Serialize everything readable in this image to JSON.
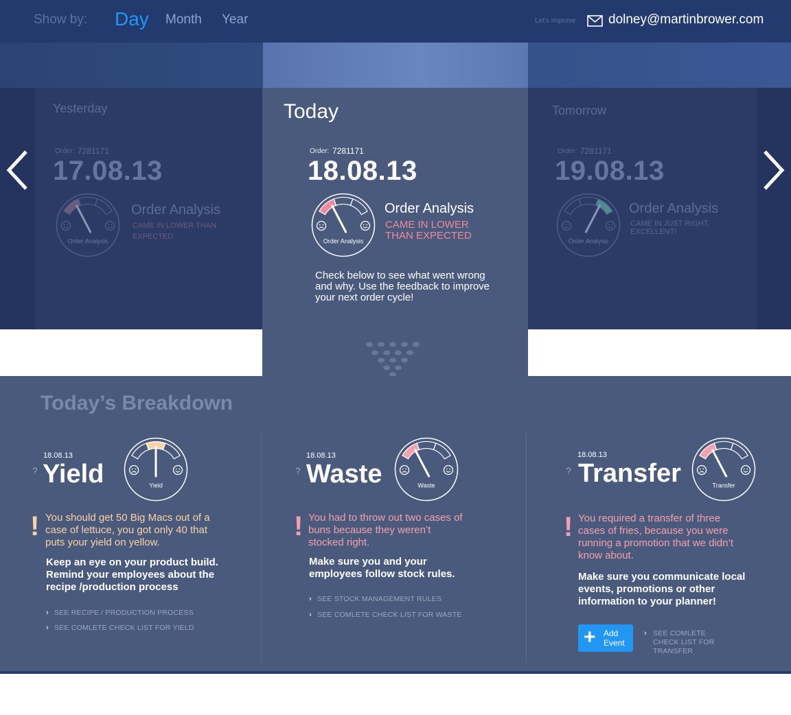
{
  "header": {
    "show_by_label": "Show by:",
    "periods": [
      {
        "label": "Day",
        "active": true
      },
      {
        "label": "Month",
        "active": false
      },
      {
        "label": "Year",
        "active": false
      }
    ],
    "improve_label": "Let's improve",
    "email": "dolney@martinbrower.com",
    "accent": "#2196f3"
  },
  "carousel": {
    "yesterday": {
      "label": "Yesterday",
      "order_label": "Order:",
      "order_number": "7281171",
      "date": "17.08.13",
      "gauge_label": "Order Analysis",
      "analysis_title": "Order Analysis",
      "analysis_result": "CAME IN LOWER THAN EXPECTED",
      "gauge_level": 0.25
    },
    "today": {
      "label": "Today",
      "order_label": "Order:",
      "order_number": "7281171",
      "date": "18.08.13",
      "gauge_label": "Order Analysis",
      "analysis_title": "Order Analysis",
      "analysis_result": "CAME IN LOWER THAN EXPECTED",
      "message": "Check below to see what went wrong and why. Use the feedback to improve your next order cycle!",
      "gauge_level": 0.25
    },
    "tomorrow": {
      "label": "Tomorrow",
      "order_label": "Order:",
      "order_number": "7281171",
      "date": "19.08.13",
      "gauge_label": "Order Analysis",
      "analysis_title": "Order Analysis",
      "analysis_result": "CAME IN JUST RIGHT. EXCELLENT!",
      "gauge_level": 0.75
    }
  },
  "breakdown": {
    "title": "Today’s Breakdown",
    "items": [
      {
        "date": "18.08.13",
        "help": "?",
        "title": "Yield",
        "gauge_label": "Yield",
        "gauge_level": 0.5,
        "alert": "!",
        "message": "You should get 50 Big Macs out of a case of lettuce, you got only 40 that puts your yield on yellow.",
        "advice": "Keep an eye on your product build. Remind your employees about the recipe /production process",
        "links": [
          "SEE RECIPE / PRODUCTION PROCESS",
          "SEE COMLETE CHECK LIST FOR YIELD"
        ],
        "color": "#fbd3a6"
      },
      {
        "date": "18.08.13",
        "help": "?",
        "title": "Waste",
        "gauge_label": "Waste",
        "gauge_level": 0.25,
        "alert": "!",
        "message": "You had to throw out two cases of buns because they weren’t stocked right.",
        "advice": "Make sure you and your employees follow stock rules.",
        "links": [
          "SEE STOCK MANAGEMENT RULES",
          "SEE COMLETE CHECK LIST FOR WASTE"
        ],
        "color": "#f5a0ac"
      },
      {
        "date": "18.08.13",
        "help": "?",
        "title": "Transfer",
        "gauge_label": "Transfer",
        "gauge_level": 0.25,
        "alert": "!",
        "message": "You required a transfer of three cases of fries, because you were running a promotion that we didn’t know about.",
        "advice": "Make sure you communicate local events, promotions or other information to your planner!",
        "links": [
          "SEE COMLETE CHECK LIST FOR TRANSFER"
        ],
        "add_event_label": "Add Event",
        "color": "#f5a0ac"
      }
    ]
  },
  "colors": {
    "low": "#f08a9b",
    "medium": "#fbd3a6",
    "good": "#4f8c8f"
  }
}
